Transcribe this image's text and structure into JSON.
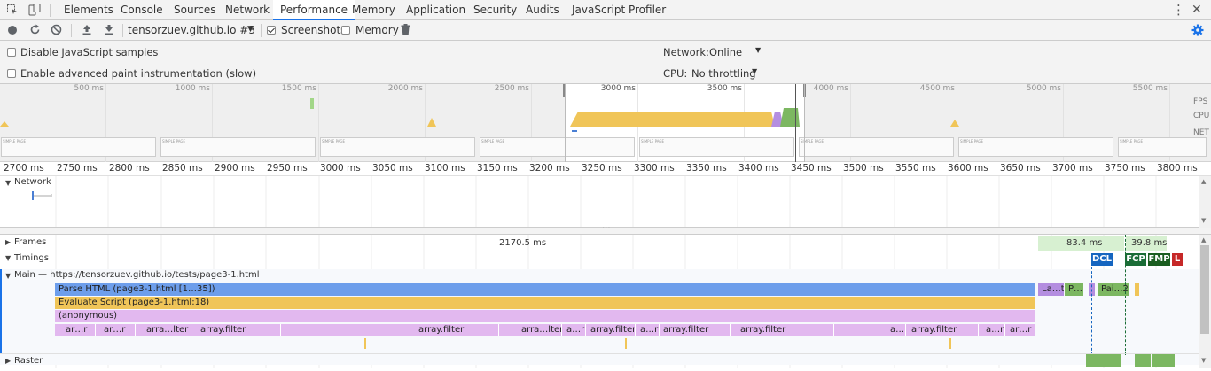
{
  "tabs": {
    "items": [
      "Elements",
      "Console",
      "Sources",
      "Network",
      "Performance",
      "Memory",
      "Application",
      "Security",
      "Audits",
      "JavaScript Profiler"
    ],
    "active": "Performance",
    "more_icon": "⋮",
    "close_icon": "✕"
  },
  "toolbar": {
    "profile_select": "tensorzuev.github.io #3",
    "screenshots_label": "Screenshots",
    "memory_label": "Memory",
    "screenshots_checked": true,
    "memory_checked": false
  },
  "settings": {
    "disable_js_samples": "Disable JavaScript samples",
    "adv_paint": "Enable advanced paint instrumentation (slow)",
    "network_label": "Network:",
    "network_value": "Online",
    "cpu_label": "CPU:",
    "cpu_value": "No throttling"
  },
  "overview": {
    "ticks": [
      "500 ms",
      "1000 ms",
      "1500 ms",
      "2000 ms",
      "2500 ms",
      "3000 ms",
      "3500 ms",
      "4000 ms",
      "4500 ms",
      "5000 ms",
      "5500 ms"
    ],
    "side_labels": [
      "FPS",
      "CPU",
      "NET"
    ],
    "screenshot_text": "SIMPLE PAGE"
  },
  "ruler": {
    "ticks": [
      "2700 ms",
      "2750 ms",
      "2800 ms",
      "2850 ms",
      "2900 ms",
      "2950 ms",
      "3000 ms",
      "3050 ms",
      "3100 ms",
      "3150 ms",
      "3200 ms",
      "3250 ms",
      "3300 ms",
      "3350 ms",
      "3400 ms",
      "3450 ms",
      "3500 ms",
      "3550 ms",
      "3600 ms",
      "3650 ms",
      "3700 ms",
      "3750 ms",
      "3800 ms"
    ]
  },
  "tracks": {
    "network": "Network",
    "frames": "Frames",
    "frame_duration_1": "2170.5 ms",
    "frame_duration_2": "83.4 ms",
    "frame_duration_3": "39.8 ms",
    "timings": "Timings",
    "main": "Main — https://tensorzuev.github.io/tests/page3-1.html",
    "raster": "Raster"
  },
  "timings": {
    "dcl": "DCL",
    "fcp": "FCP",
    "fmp": "FMP",
    "l": "L"
  },
  "flame": {
    "parse_html": "Parse HTML (page3-1.html [1…35])",
    "evaluate_script": "Evaluate Script (page3-1.html:18)",
    "anonymous": "(anonymous)",
    "right_bars": [
      "La…t",
      "P…",
      "Pai…2"
    ],
    "level4": [
      "ar…r",
      "ar…r",
      "arra…lter",
      "array.filter",
      "array.filter",
      "arra…lter",
      "a…r",
      "array.filter",
      "a…r",
      "array.filter",
      "array.filter",
      "a…",
      "array.filter",
      "a…r",
      "ar…r"
    ]
  },
  "colors": {
    "parse_html": "#6d9eeb",
    "evaluate_script": "#f0c558",
    "js": "#e2b8ef",
    "dcl": "#1565c0",
    "fcp": "#1b6d37",
    "fmp": "#1b5e20",
    "l": "#c62828",
    "paint": "#7cb761",
    "layout": "#b48ee0"
  }
}
